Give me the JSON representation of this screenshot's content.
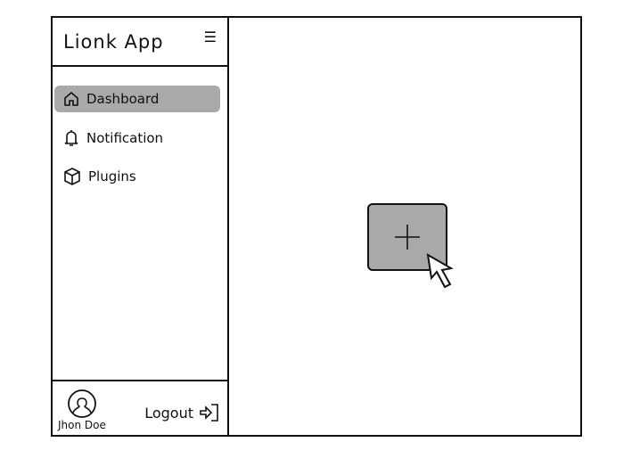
{
  "app": {
    "title": "Lionk App",
    "menu_icon": "hamburger-icon"
  },
  "sidebar": {
    "items": [
      {
        "label": "Dashboard",
        "icon": "home-icon",
        "active": true
      },
      {
        "label": "Notification",
        "icon": "bell-icon",
        "active": false
      },
      {
        "label": "Plugins",
        "icon": "cube-icon",
        "active": false
      }
    ]
  },
  "footer": {
    "user_name": "Jhon Doe",
    "logout_label": "Logout"
  },
  "main": {
    "add_icon": "plus-icon"
  },
  "colors": {
    "highlight": "#a9a9a9",
    "stroke": "#111111"
  }
}
